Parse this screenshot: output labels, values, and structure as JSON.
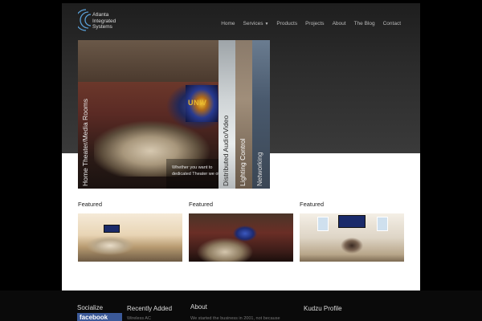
{
  "brand": {
    "logo_lines": [
      "Atlanta",
      "Integrated",
      "Systems"
    ]
  },
  "nav": {
    "items": [
      {
        "label": "Home"
      },
      {
        "label": "Services",
        "has_dropdown": true
      },
      {
        "label": "Products"
      },
      {
        "label": "Projects"
      },
      {
        "label": "About"
      },
      {
        "label": "The Blog"
      },
      {
        "label": "Contact"
      }
    ]
  },
  "slider": {
    "main_label": "Home Theater/Media Rooms",
    "main_caption": "Whether you want to dedicated Theater we of",
    "screen_text": "UNIV",
    "tabs": [
      {
        "label": "Distributed Audio/Video"
      },
      {
        "label": "Lighting Control"
      },
      {
        "label": "Networking"
      }
    ]
  },
  "featured": [
    {
      "title": "Featured",
      "image": "living-room"
    },
    {
      "title": "Featured",
      "image": "home-theater"
    },
    {
      "title": "Featured",
      "image": "family-room"
    }
  ],
  "footer": {
    "socialize": "Socialize",
    "facebook": "facebook",
    "recently_added": "Recently Added",
    "recently_added_item": "Wireless AC",
    "about": "About",
    "about_text": "We started the business in 2001, not because",
    "kudzu": "Kudzu Profile"
  },
  "colors": {
    "header_dark": "#2b2b2b",
    "facebook_blue": "#3b5998",
    "page_bg": "#000000"
  }
}
